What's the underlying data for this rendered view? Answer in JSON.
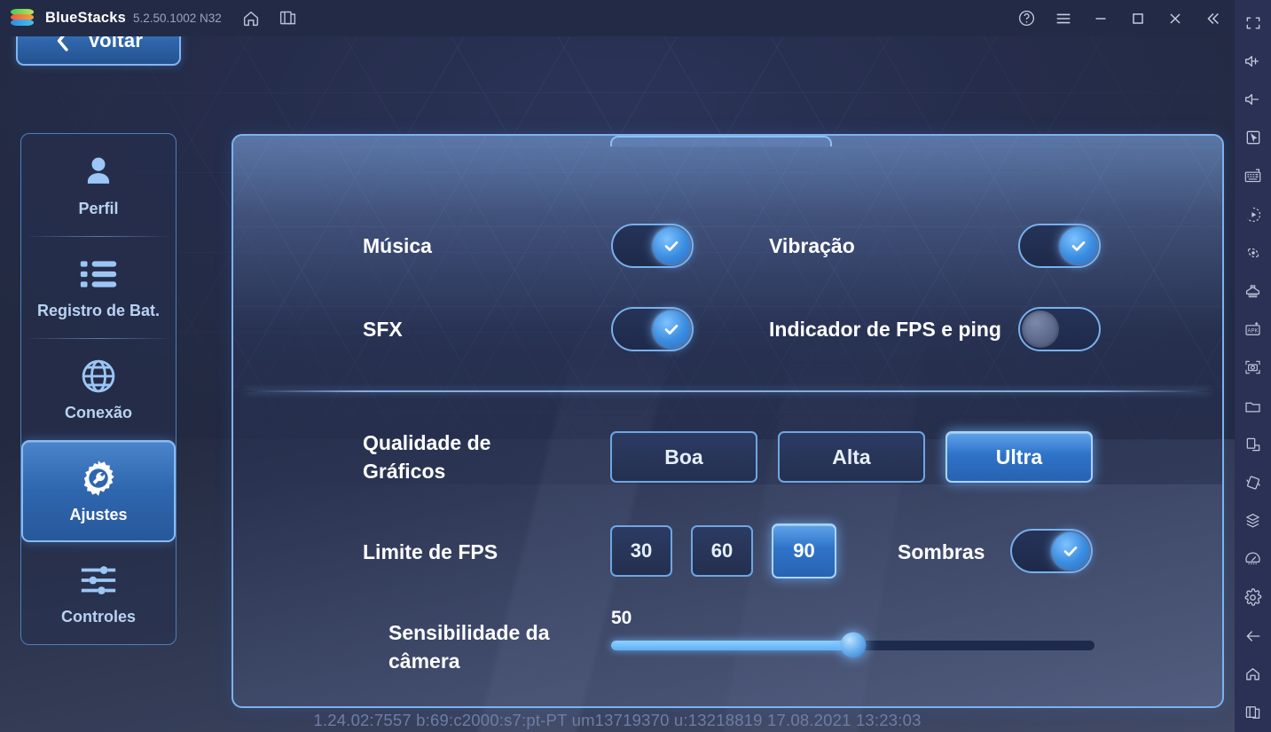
{
  "window": {
    "app_name": "BlueStacks",
    "version": "5.2.50.1002 N32",
    "logo_icon": "bluestacks-logo-icon",
    "titlebar_left_icons": [
      {
        "name": "home-icon",
        "label": "Home"
      },
      {
        "name": "multi-instance-icon",
        "label": "Multi-instance"
      }
    ],
    "titlebar_right_icons": [
      {
        "name": "help-icon",
        "label": "Help"
      },
      {
        "name": "menu-icon",
        "label": "Menu"
      },
      {
        "name": "minimize-icon",
        "label": "Minimize"
      },
      {
        "name": "maximize-icon",
        "label": "Maximize"
      },
      {
        "name": "close-icon",
        "label": "Close"
      },
      {
        "name": "collapse-sidebar-icon",
        "label": "Collapse"
      }
    ]
  },
  "toolbar": {
    "items": [
      {
        "name": "fullscreen-icon",
        "label": "Tela cheia"
      },
      {
        "name": "volume-up-icon",
        "label": "Aumentar volume"
      },
      {
        "name": "volume-down-icon",
        "label": "Diminuir volume"
      },
      {
        "name": "game-controls-icon",
        "label": "Controles do jogo"
      },
      {
        "name": "keyboard-icon",
        "label": "Teclado"
      },
      {
        "name": "macro-recorder-icon",
        "label": "Gravador de macro"
      },
      {
        "name": "script-icon",
        "label": "Script"
      },
      {
        "name": "eco-mode-icon",
        "label": "Modo eco"
      },
      {
        "name": "install-apk-icon",
        "label": "Instalar APK"
      },
      {
        "name": "screenshot-icon",
        "label": "Captura de tela"
      },
      {
        "name": "media-manager-icon",
        "label": "Gerenciador de mídia"
      },
      {
        "name": "rotate-icon",
        "label": "Girar"
      },
      {
        "name": "shake-icon",
        "label": "Agitar"
      },
      {
        "name": "multi-instance-manager-icon",
        "label": "Gerenciador de instâncias"
      },
      {
        "name": "performance-icon",
        "label": "Desempenho"
      },
      {
        "name": "settings-gear-icon",
        "label": "Configurações"
      },
      {
        "name": "back-arrow-icon",
        "label": "Voltar"
      },
      {
        "name": "home-icon",
        "label": "Início"
      },
      {
        "name": "recents-icon",
        "label": "Recentes"
      }
    ]
  },
  "back_button": {
    "label": "Voltar",
    "icon": "chevron-left-icon"
  },
  "side_menu": {
    "items": [
      {
        "label": "Perfil",
        "icon": "user-icon",
        "active": false
      },
      {
        "label": "Registro de Bat.",
        "icon": "list-icon",
        "active": false
      },
      {
        "label": "Conexão",
        "icon": "globe-icon",
        "active": false
      },
      {
        "label": "Ajustes",
        "icon": "gear-wrench-icon",
        "active": true
      },
      {
        "label": "Controles",
        "icon": "sliders-icon",
        "active": false
      }
    ]
  },
  "settings": {
    "toggles": [
      {
        "key": "musica",
        "label": "Música",
        "state": "on"
      },
      {
        "key": "vibracao",
        "label": "Vibração",
        "state": "on"
      },
      {
        "key": "sfx",
        "label": "SFX",
        "state": "on"
      },
      {
        "key": "fps_ping",
        "label": "Indicador de FPS e ping",
        "state": "off"
      },
      {
        "key": "sombras",
        "label": "Sombras",
        "state": "on"
      }
    ],
    "graphics_quality": {
      "label": "Qualidade de Gráficos",
      "label_line1": "Qualidade de",
      "label_line2": "Gráficos",
      "options": [
        "Boa",
        "Alta",
        "Ultra"
      ],
      "selected": "Ultra"
    },
    "fps_limit": {
      "label": "Limite de FPS",
      "options": [
        "30",
        "60",
        "90"
      ],
      "selected": "90"
    },
    "camera_sensitivity": {
      "label": "Sensibilidade da câmera",
      "label_line1": "Sensibilidade da",
      "label_line2": "câmera",
      "value": "50",
      "min": 0,
      "max": 100,
      "fill_percent": 50
    }
  },
  "status_line": "1.24.02:7557 b:69:c2000:s7:pt-PT um13719370 u:13218819 17.08.2021 13:23:03",
  "colors": {
    "accent_blue": "#7db2ee",
    "selected_blue": "#2f73c9",
    "panel_bg": "#2b3860",
    "titlebar_bg": "#232a45",
    "toolbar_bg": "#2a3154",
    "text_white": "#ffffff",
    "menu_label": "#b9d2f2",
    "status_text": "#6e7da6"
  }
}
